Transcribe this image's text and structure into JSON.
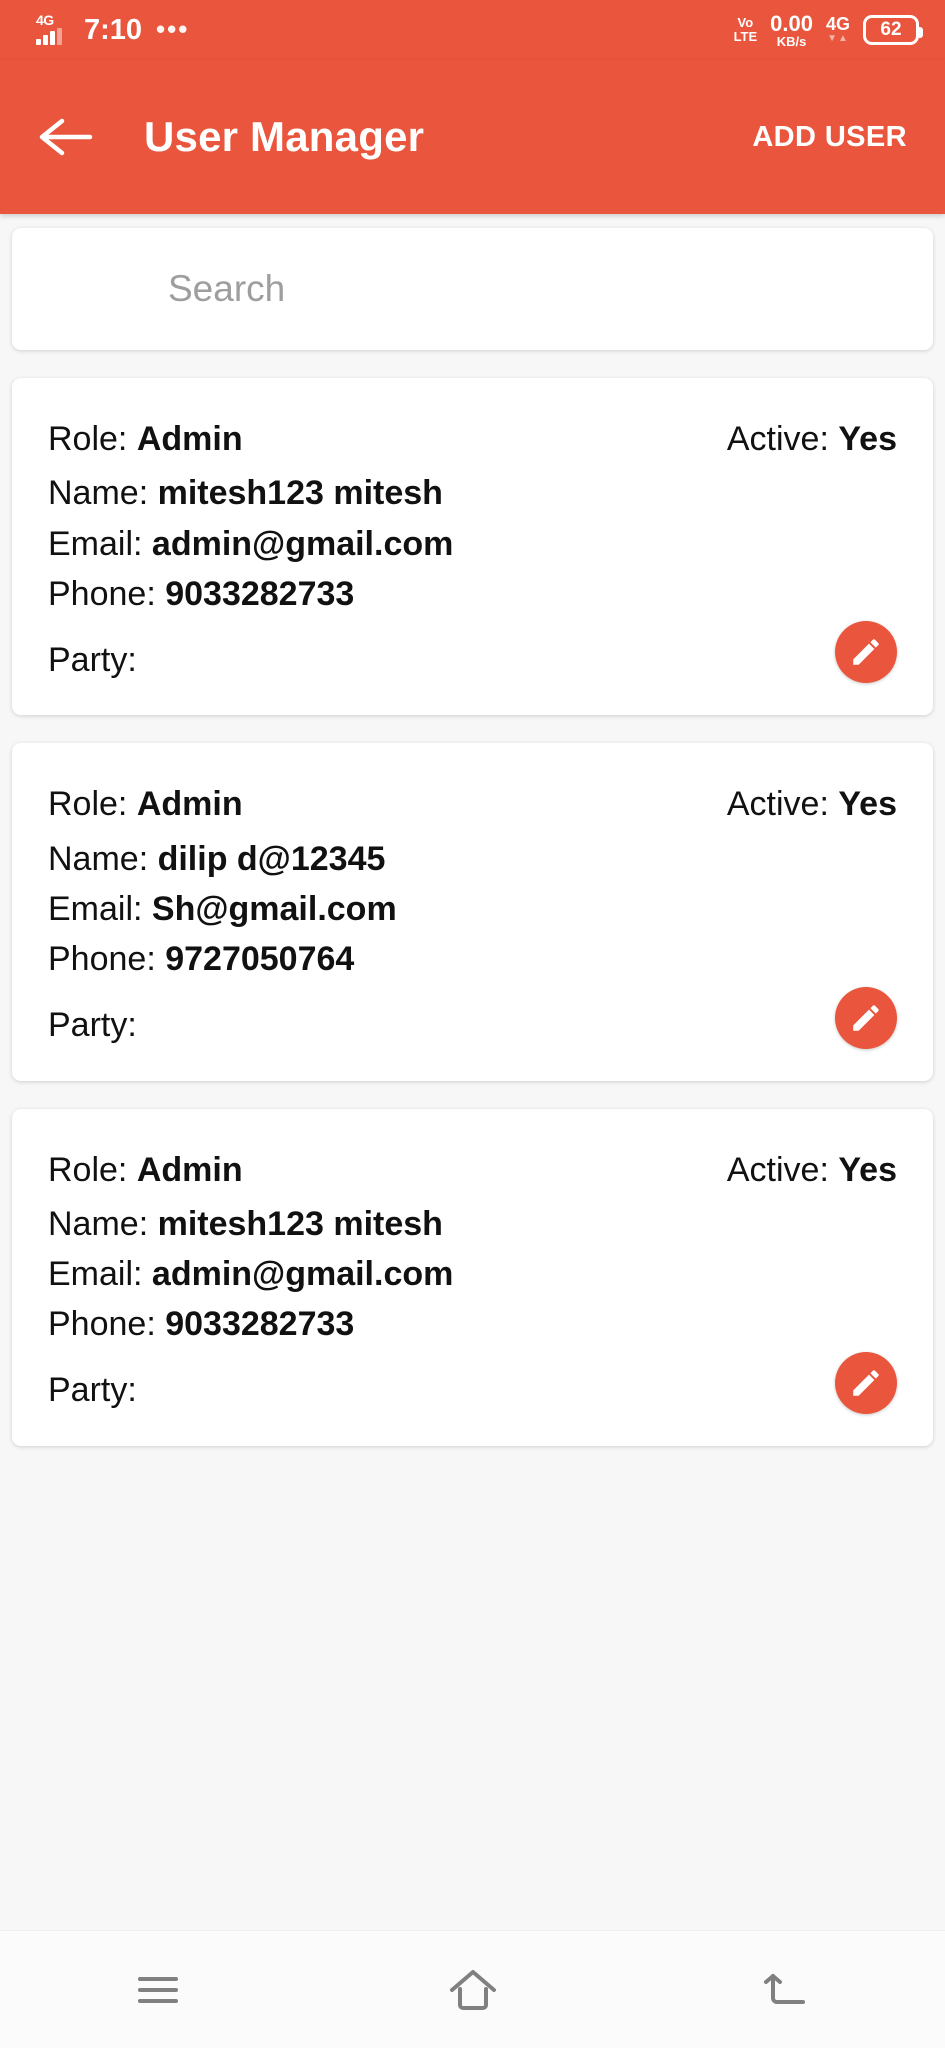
{
  "status_bar": {
    "network_label": "4G",
    "time": "7:10",
    "more_dots": "•••",
    "volte_line1": "Vo",
    "volte_line2": "LTE",
    "net_speed_value": "0.00",
    "net_speed_unit": "KB/s",
    "data_tag": "4G",
    "data_arrows": "▼▲",
    "battery_level": "62"
  },
  "app_bar": {
    "back_icon": "arrow-left-icon",
    "title": "User Manager",
    "add_user_label": "ADD USER"
  },
  "search": {
    "value": "",
    "placeholder": "Search"
  },
  "labels": {
    "role": "Role:",
    "active": "Active:",
    "name": "Name:",
    "email": "Email:",
    "phone": "Phone:",
    "party": "Party:"
  },
  "users": [
    {
      "role": "Admin",
      "active": "Yes",
      "name": "mitesh123 mitesh",
      "email": "admin@gmail.com",
      "phone": "9033282733",
      "party": "",
      "edit_icon": "pencil-icon"
    },
    {
      "role": "Admin",
      "active": "Yes",
      "name": "dilip d@12345",
      "email": "Sh@gmail.com",
      "phone": "9727050764",
      "party": "",
      "edit_icon": "pencil-icon"
    },
    {
      "role": "Admin",
      "active": "Yes",
      "name": "mitesh123 mitesh",
      "email": "admin@gmail.com",
      "phone": "9033282733",
      "party": "",
      "edit_icon": "pencil-icon"
    }
  ],
  "nav_bar": {
    "recents_icon": "menu-icon",
    "home_icon": "home-icon",
    "back_icon": "back-arrow-icon"
  },
  "colors": {
    "primary": "#e9563d",
    "page_background": "#f7f7f7",
    "card_background": "#ffffff",
    "text": "#111111",
    "placeholder": "#9e9e9e",
    "nav_icon": "#808080"
  }
}
